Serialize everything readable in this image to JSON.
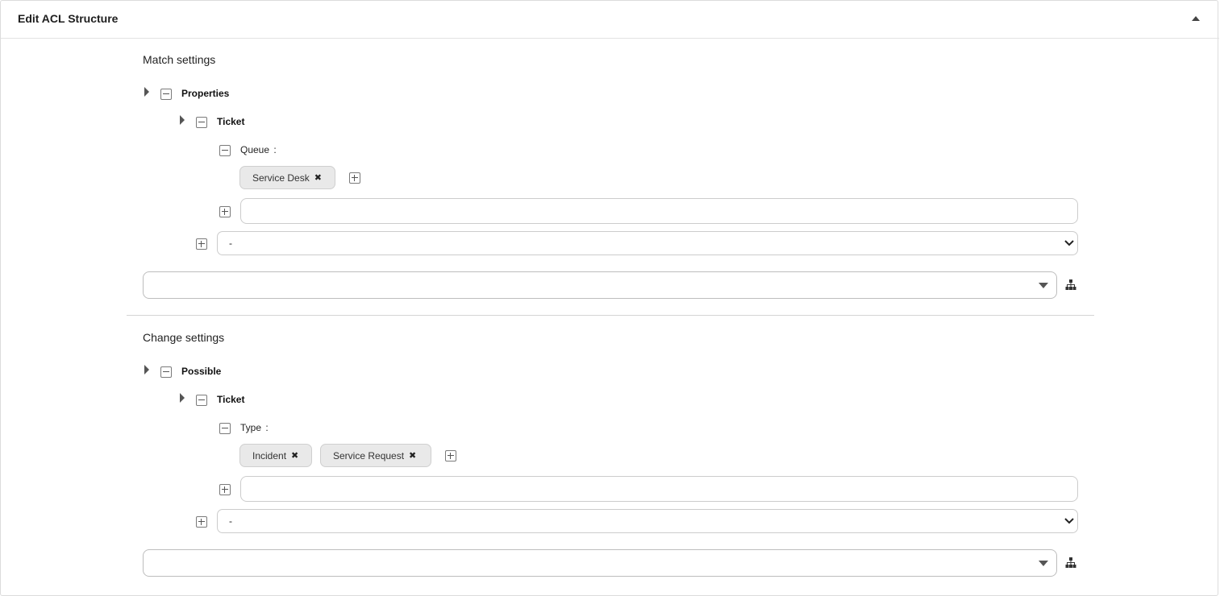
{
  "header": {
    "title": "Edit ACL Structure",
    "collapse_icon": "caret-up-icon"
  },
  "match": {
    "title": "Match settings",
    "root_label": "Properties",
    "object_label": "Ticket",
    "attribute": {
      "label": "Queue",
      "separator": ":",
      "chips": [
        "Service Desk"
      ]
    },
    "add_attribute_select_value": "-",
    "structure_select_value": ""
  },
  "change": {
    "title": "Change settings",
    "root_label": "Possible",
    "object_label": "Ticket",
    "attribute": {
      "label": "Type",
      "separator": ":",
      "chips": [
        "Incident",
        "Service Request"
      ]
    },
    "add_attribute_select_value": "-",
    "structure_select_value": ""
  },
  "icons": {
    "chip_remove": "✖",
    "tree": "sitemap-icon",
    "plus": "plus-square-icon",
    "minus": "minus-square-icon",
    "expand": "caret-right-icon"
  }
}
